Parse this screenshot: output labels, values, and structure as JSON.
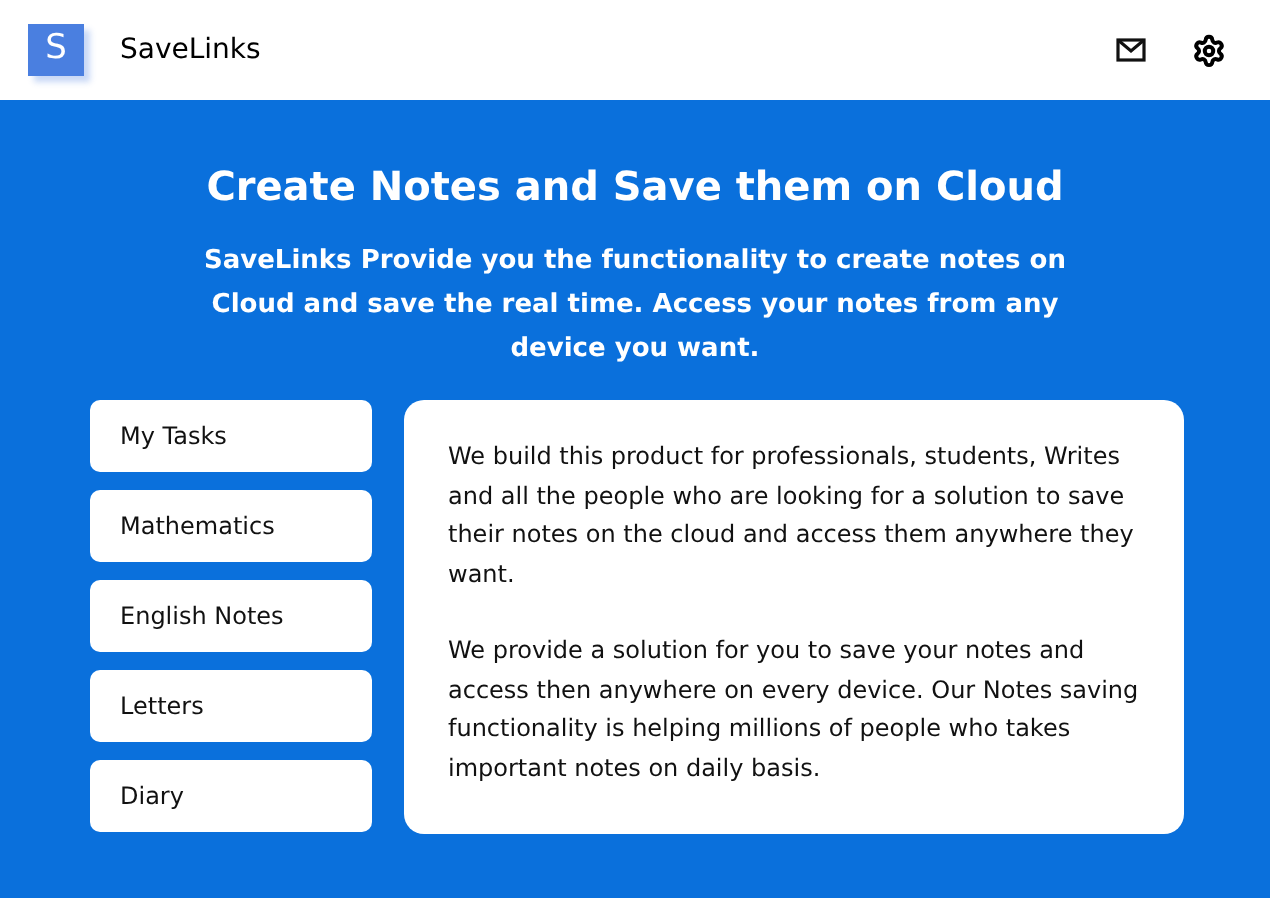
{
  "header": {
    "logo_letter": "S",
    "brand": "SaveLinks"
  },
  "hero": {
    "title": "Create Notes and Save them on Cloud",
    "subtitle": "SaveLinks Provide you the functionality to create notes on Cloud and save the real time. Access your notes from any device you want."
  },
  "sidebar": {
    "items": [
      "My Tasks",
      "Mathematics",
      "English Notes",
      "Letters",
      "Diary"
    ]
  },
  "content": {
    "paragraphs": [
      "We build this product for professionals, students, Writes and all the people who are looking for a solution to save their notes on the cloud and access them anywhere they want.",
      "We provide a solution for you to save your notes and access then anywhere on every device. Our Notes saving functionality is helping millions of people who takes important notes on daily basis."
    ]
  }
}
